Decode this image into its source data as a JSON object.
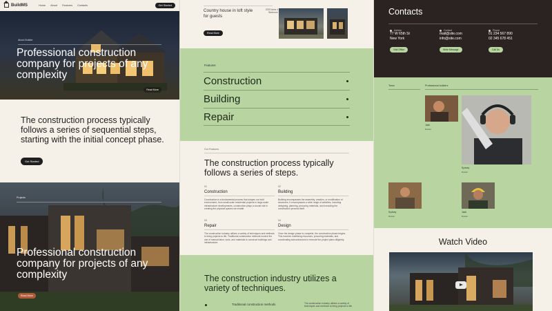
{
  "brand": {
    "name": "BuildMS"
  },
  "nav": {
    "links": [
      "Home",
      "About",
      "Features",
      "Contacts"
    ],
    "cta": "Get Started"
  },
  "hero1": {
    "kicker": "About Builder",
    "title": "Professional construction company for projects of any complexity",
    "button": "Read More"
  },
  "intro": {
    "text": "The construction process typically follows a series of sequential steps, starting with the initial concept phase.",
    "button": "Get Started"
  },
  "hero2": {
    "kicker": "Projects",
    "title": "Professional construction company for projects of any complexity",
    "button": "Read More"
  },
  "project": {
    "title": "Country house in loft style for guests",
    "meta": "2023 Area 4 Bedroom",
    "button": "Read More"
  },
  "features": {
    "label": "Features",
    "items": [
      {
        "name": "Construction"
      },
      {
        "name": "Building"
      },
      {
        "name": "Repair"
      }
    ]
  },
  "steps": {
    "kicker": "Our Features",
    "title": "The construction process typically follows a series of steps.",
    "items": [
      {
        "num": "01",
        "title": "Construction",
        "text": "Construction is a fundamental process that shapes our built environment, from small-scale residential projects to large-scale infrastructure developments, construction plays a crucial role in creating the physical spaces we inhabit."
      },
      {
        "num": "02",
        "title": "Building",
        "text": "Building encompasses the assembly, creation, or modification of structures. It encompasses a wide range of activities, including designing, planning, procuring materials, and executing the construction process itself."
      },
      {
        "num": "03",
        "title": "Repair",
        "text": "The construction industry utilizes a variety of techniques and methods to bring projects to life. Traditional construction methods involve the use of manual labor, tools, and materials to construct buildings and infrastructure."
      },
      {
        "num": "04",
        "title": "Design",
        "text": "Once the design phase is complete, the construction phase begins. This involves mobilizing resources, procuring materials, and coordinating subcontractors to execute the project plans diligently."
      }
    ]
  },
  "techniques": {
    "title": "The construction industry utilizes a variety of techniques.",
    "item": "Traditional construction methods",
    "desc": "The construction industry utilizes a variety of techniques and methods to bring projects to life."
  },
  "contacts": {
    "title": "Contacts",
    "blocks": [
      {
        "label": "Adress",
        "lines": [
          "77 W 65th St",
          "New York"
        ],
        "button": "Visit Office"
      },
      {
        "label": "Contact",
        "lines": [
          "mail@site.com",
          "info@site.com"
        ],
        "button": "Write Message"
      },
      {
        "label": "Phone",
        "lines": [
          "01 234 567 890",
          "02 345 678 451"
        ],
        "button": "Call Us"
      }
    ]
  },
  "team": {
    "label": "Team",
    "sublabel": "Professional builders",
    "members": [
      {
        "name": "Jack",
        "role": "Builder"
      },
      {
        "name": "Sydney",
        "role": "Builder"
      },
      {
        "name": "Sydney",
        "role": "Builder"
      },
      {
        "name": "Jack",
        "role": "Builder"
      }
    ]
  },
  "video": {
    "title": "Watch Video"
  }
}
